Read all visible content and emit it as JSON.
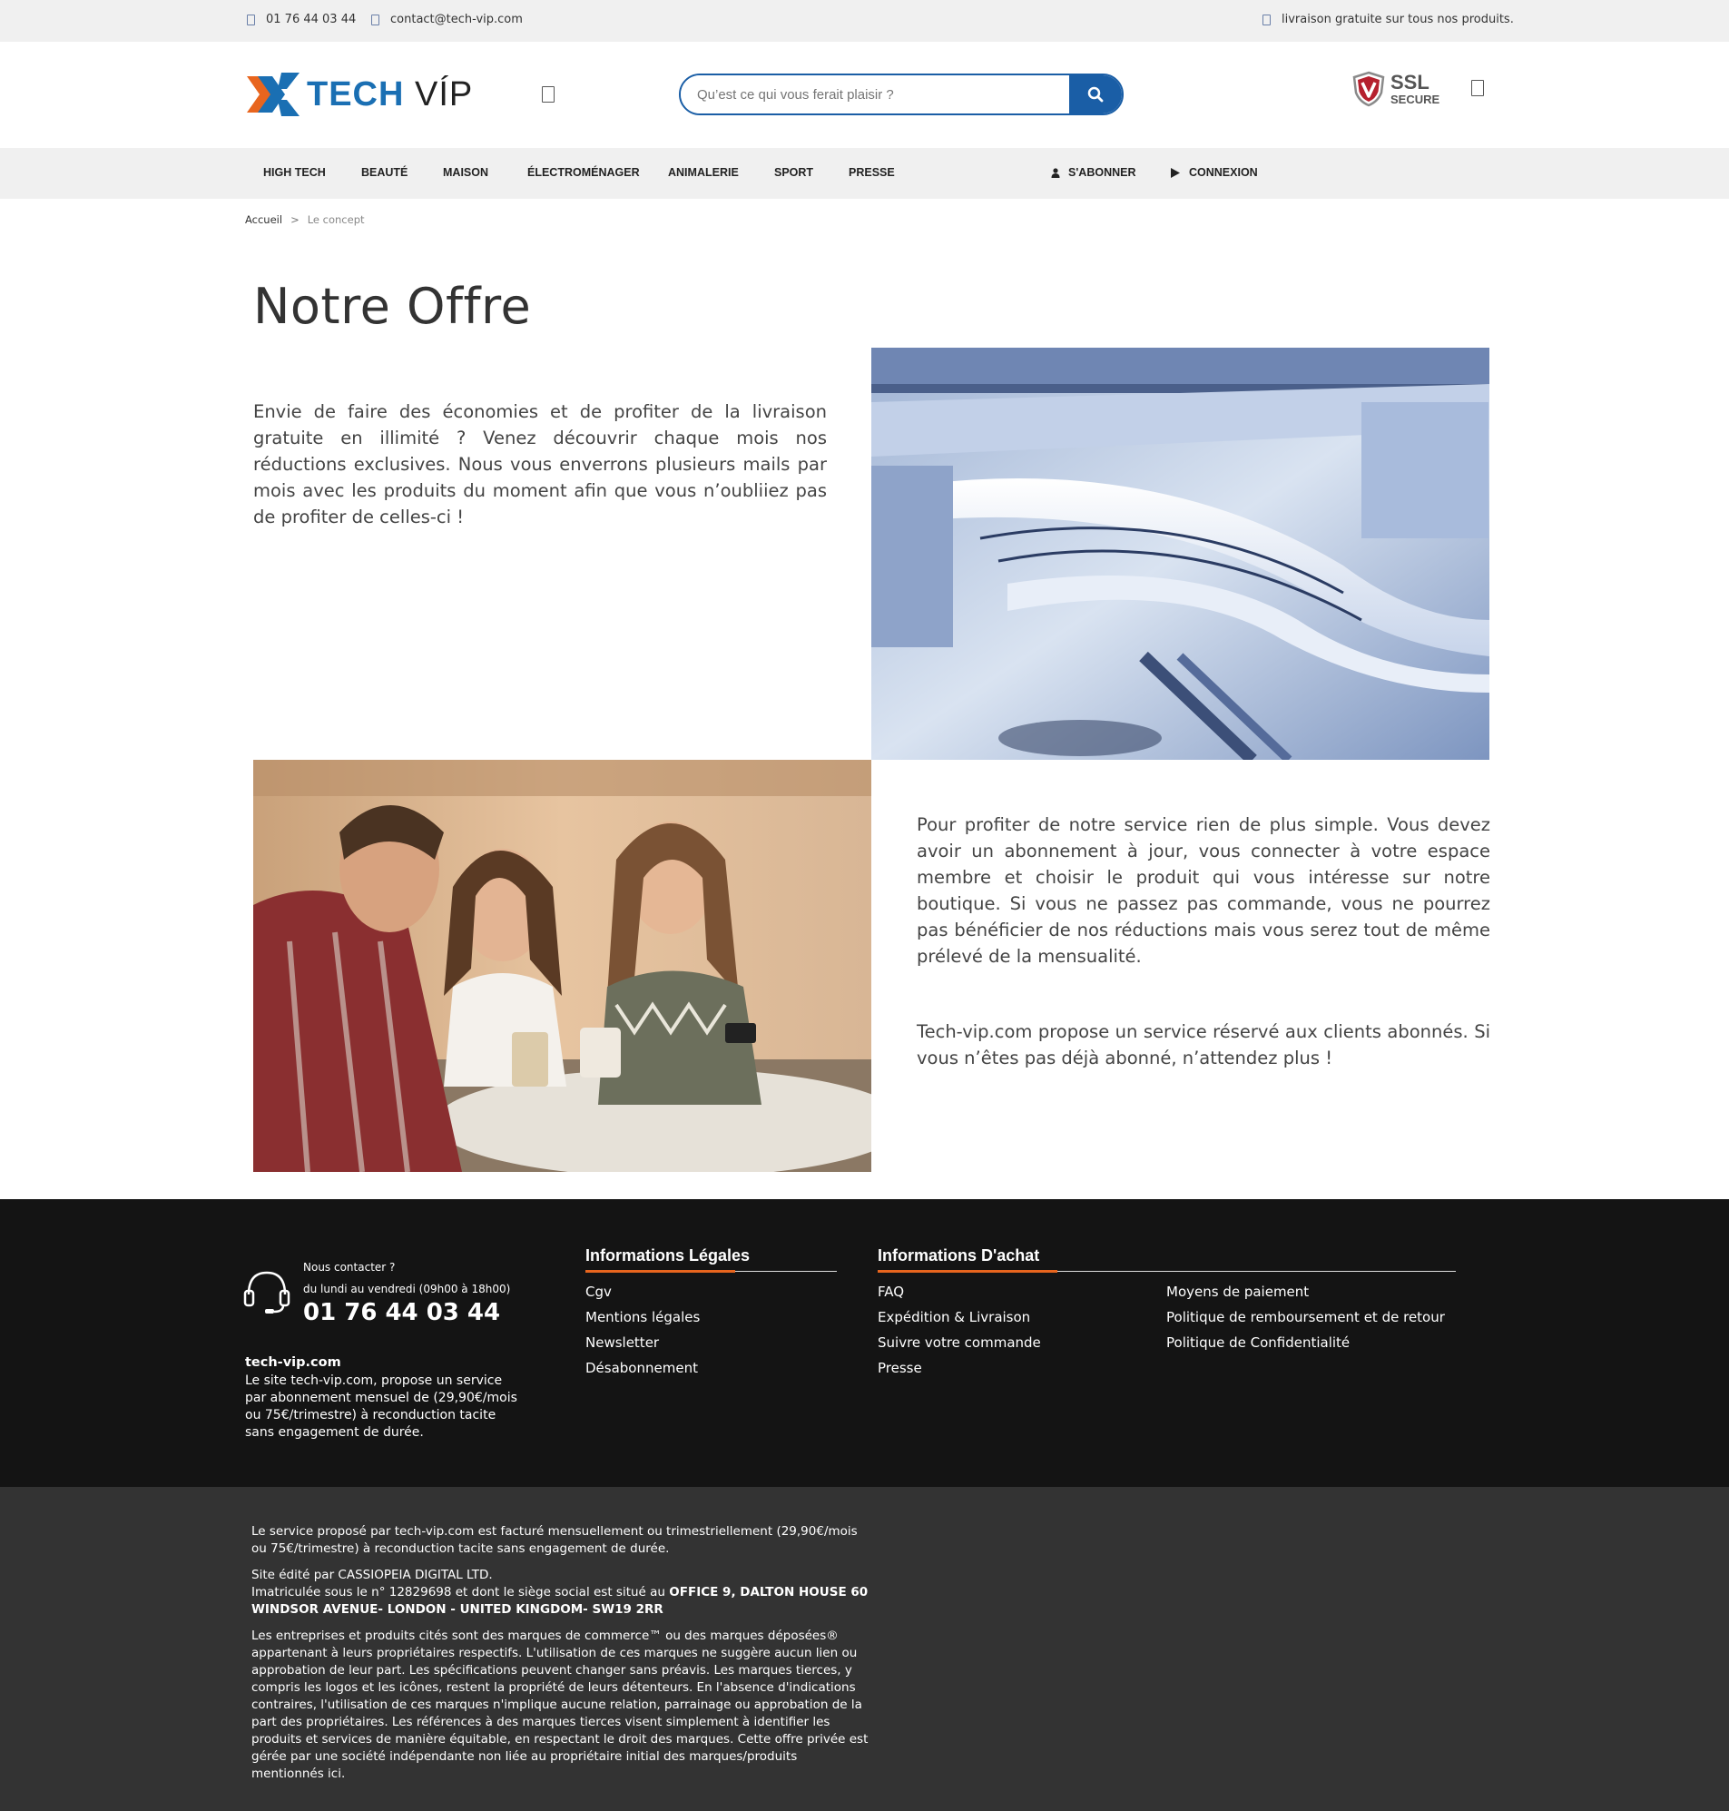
{
  "topbar": {
    "phone": "01 76 44 03 44",
    "email": "contact@tech-vip.com",
    "shipping_note": "livraison gratuite sur tous nos produits."
  },
  "header": {
    "logo_tech": "TECH",
    "logo_vip": "VÍP",
    "search_placeholder": "Qu’est ce qui vous ferait plaisir ?",
    "ssl_line1": "SSL",
    "ssl_line2": "SECURE"
  },
  "nav": {
    "items": [
      "HIGH TECH",
      "BEAUTÉ",
      "MAISON",
      "ÉLECTROMÉNAGER",
      "ANIMALERIE",
      "SPORT",
      "PRESSE"
    ],
    "subscribe": "S'ABONNER",
    "login": "CONNEXION"
  },
  "breadcrumb": {
    "home": "Accueil",
    "sep": ">",
    "current": "Le concept"
  },
  "main": {
    "title": "Notre Offre",
    "para1": "Envie de faire des économies et de profiter de la livraison gratuite en illimité ? Venez découvrir chaque mois nos réductions exclusives. Nous vous enverrons plusieurs mails par mois avec les produits du moment afin que vous n’oubliiez pas de profiter de celles-ci !",
    "para2": "Pour profiter de notre service rien de plus simple. Vous devez avoir un abonnement à jour, vous connecter à votre espace membre et choisir le produit qui vous intéresse sur notre boutique. Si vous ne passez pas commande, vous ne pourrez pas bénéficier de nos réductions mais vous serez tout de même prélevé de la mensualité.",
    "para3": "Tech-vip.com propose un service réservé aux clients abonnés. Si vous n’êtes pas déjà abonné, n’attendez plus !"
  },
  "footer": {
    "contact_label": "Nous contacter ?",
    "contact_hours": "du lundi au vendredi (09h00 à 18h00)",
    "contact_phone": "01 76 44 03 44",
    "site_name": "tech-vip.com",
    "site_desc": "Le site tech-vip.com, propose un service par abonnement mensuel de (29,90€/mois ou 75€/trimestre) à reconduction tacite sans engagement de durée.",
    "legal_title": "Informations Légales",
    "legal_links": [
      "Cgv",
      "Mentions légales",
      "Newsletter",
      "Désabonnement"
    ],
    "purchase_title": "Informations D'achat",
    "purchase_links_col1": [
      "FAQ",
      "Expédition & Livraison",
      "Suivre votre commande",
      "Presse"
    ],
    "purchase_links_col2": [
      "Moyens de paiement",
      "Politique de remboursement et de retour",
      "Politique de Confidentialité"
    ]
  },
  "legal": {
    "p1": "Le service proposé par tech-vip.com est facturé mensuellement ou trimestriellement (29,90€/mois ou 75€/trimestre) à reconduction tacite sans engagement de durée.",
    "p2_line1": "Site édité par CASSIOPEIA DIGITAL LTD.",
    "p2_line2": "Imatriculée sous le n° 12829698 et dont le siège social est situé au ",
    "p2_address": "OFFICE 9, DALTON HOUSE 60 WINDSOR AVENUE- LONDON - UNITED KINGDOM- SW19 2RR",
    "p3": "Les entreprises et produits cités sont des marques de commerce™ ou des marques déposées® appartenant à leurs propriétaires respectifs. L'utilisation de ces marques ne suggère aucun lien ou approbation de leur part. Les spécifications peuvent changer sans préavis. Les marques tierces, y compris les logos et les icônes, restent la propriété de leurs détenteurs. En l'absence d'indications contraires, l'utilisation de ces marques n'implique aucune relation, parrainage ou approbation de la part des propriétaires. Les références à des marques tierces visent simplement à identifier les produits et services de manière équitable, en respectant le droit des marques. Cette offre privée est gérée par une société indépendante non liée au propriétaire initial des marques/produits mentionnés ici."
  },
  "colors": {
    "brand_blue": "#1a6fb3",
    "search_blue": "#1a5ea6",
    "accent_orange": "#e8651e",
    "footer_dark": "#141414",
    "legal_dark": "#333333"
  }
}
